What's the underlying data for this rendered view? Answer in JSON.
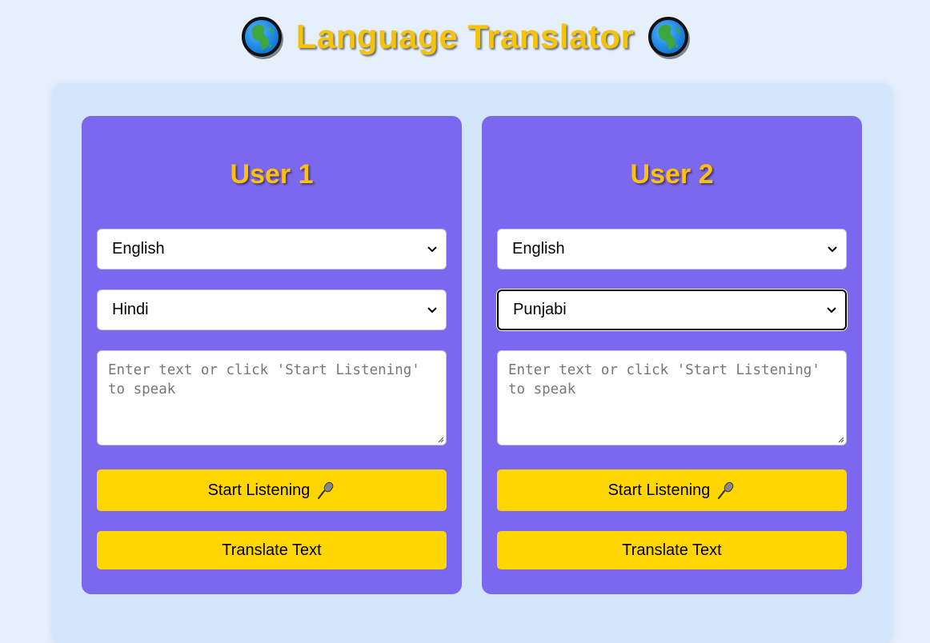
{
  "header": {
    "title": "Language Translator",
    "left_icon": "globe-africa-icon",
    "right_icon": "globe-africa-icon"
  },
  "colors": {
    "page_bg": "#e6f0fd",
    "container_bg": "#d3e6fc",
    "panel_bg": "#7b68ee",
    "heading": "#ffc107",
    "button_bg": "#ffd600"
  },
  "users": [
    {
      "heading": "User 1",
      "source_language": "English",
      "target_language": "Hindi",
      "text_value": "",
      "text_placeholder": "Enter text or click 'Start Listening' to speak",
      "listen_label": "Start Listening",
      "listen_icon": "microphone-icon",
      "translate_label": "Translate Text"
    },
    {
      "heading": "User 2",
      "source_language": "English",
      "target_language": "Punjabi",
      "text_value": "",
      "text_placeholder": "Enter text or click 'Start Listening' to speak",
      "listen_label": "Start Listening",
      "listen_icon": "microphone-icon",
      "translate_label": "Translate Text"
    }
  ]
}
